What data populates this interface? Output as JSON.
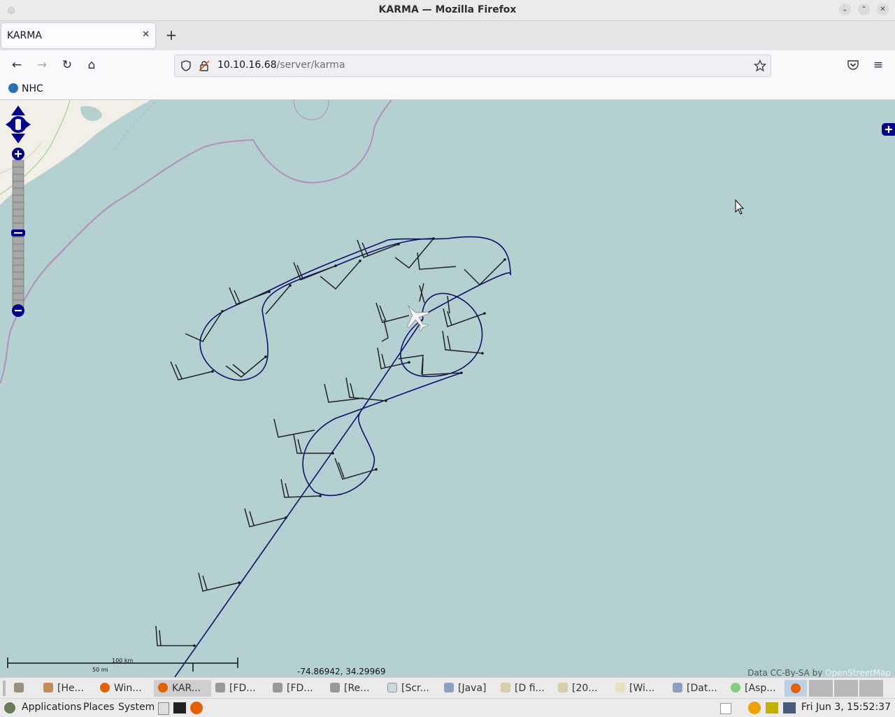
{
  "window": {
    "title": "KARMA — Mozilla Firefox"
  },
  "tab": {
    "title": "KARMA",
    "close": "✕",
    "new": "+"
  },
  "nav": {
    "url_host": "10.10.16.68",
    "url_path": "/server/karma"
  },
  "bookmarks": [
    {
      "label": "NHC"
    }
  ],
  "map": {
    "coordinates": "-74.86942, 34.29969",
    "attribution_prefix": "Data CC-By-SA by ",
    "attribution_link": "OpenStreetMap",
    "scale_km": "100 km",
    "scale_mi": "50 mi",
    "colors": {
      "ocean": "#b5d0d0",
      "land": "#f2efe9",
      "track": "#101070",
      "barbs": "#222222",
      "boundary": "#b48ebf"
    }
  },
  "taskbar": [
    {
      "label": "[He...",
      "icon": "cookie-icon"
    },
    {
      "label": "Win...",
      "icon": "firefox-icon"
    },
    {
      "label": "KAR...",
      "icon": "firefox-icon",
      "active": true
    },
    {
      "label": "[FD...",
      "icon": "gear-icon"
    },
    {
      "label": "[FD...",
      "icon": "gear-icon"
    },
    {
      "label": "[Re...",
      "icon": "gear-icon"
    },
    {
      "label": "[Scr...",
      "icon": "window-icon"
    },
    {
      "label": "[Java]",
      "icon": "java-icon"
    },
    {
      "label": "[D fi...",
      "icon": "folder-icon"
    },
    {
      "label": "[20...",
      "icon": "folder-icon"
    },
    {
      "label": "[Wi...",
      "icon": "editor-icon"
    },
    {
      "label": "[Dat...",
      "icon": "java-icon"
    },
    {
      "label": "[Asp...",
      "icon": "chat-icon"
    }
  ],
  "panel": {
    "menus": [
      "Applications",
      "Places",
      "System"
    ],
    "clock": "Fri Jun  3, 15:52:37"
  }
}
